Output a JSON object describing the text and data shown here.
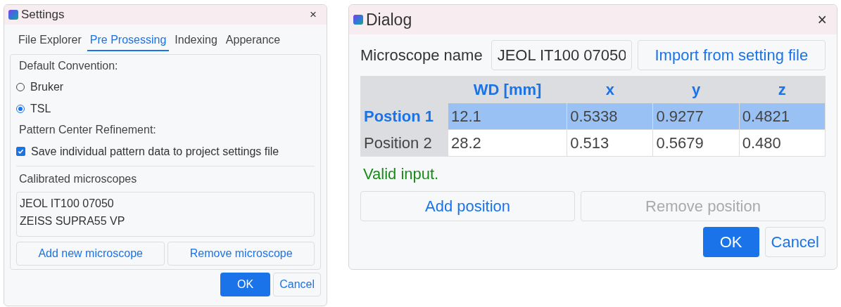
{
  "settings": {
    "title": "Settings",
    "close": "×",
    "tabs": [
      {
        "label": "File Explorer",
        "selected": false
      },
      {
        "label": "Pre Prosessing",
        "selected": true
      },
      {
        "label": "Indexing",
        "selected": false
      },
      {
        "label": "Apperance",
        "selected": false
      }
    ],
    "default_convention": {
      "label": "Default Convention:",
      "options": [
        {
          "label": "Bruker",
          "selected": false
        },
        {
          "label": "TSL",
          "selected": true
        }
      ]
    },
    "pattern_center": {
      "label": "Pattern Center Refinement:",
      "checkbox": {
        "label": "Save individual pattern data to project settings file",
        "checked": true
      }
    },
    "calibrated": {
      "label": "Calibrated microscopes",
      "items": [
        "JEOL IT100 07050",
        "ZEISS SUPRA55 VP"
      ],
      "buttons": [
        "Add new microscope",
        "Remove microscope"
      ]
    },
    "footer": {
      "ok": "OK",
      "cancel": "Cancel"
    }
  },
  "dialog": {
    "title": "Dialog",
    "close": "×",
    "microscope_label": "Microscope name",
    "microscope_name": "JEOL IT100 07050",
    "import_button": "Import from setting file",
    "table": {
      "columns": [
        "WD [mm]",
        "x",
        "y",
        "z"
      ],
      "rows": [
        {
          "header": "Postion 1",
          "cells": [
            "12.1",
            "0.5338",
            "0.9277",
            "0.4821"
          ],
          "selected": true
        },
        {
          "header": "Position 2",
          "cells": [
            "28.2",
            "0.513",
            "0.5679",
            "0.480"
          ],
          "selected": false
        }
      ]
    },
    "status": "Valid input.",
    "buttons": [
      {
        "label": "Add position",
        "disabled": false
      },
      {
        "label": "Remove position",
        "disabled": true
      }
    ],
    "footer": {
      "ok": "OK",
      "cancel": "Cancel"
    }
  }
}
